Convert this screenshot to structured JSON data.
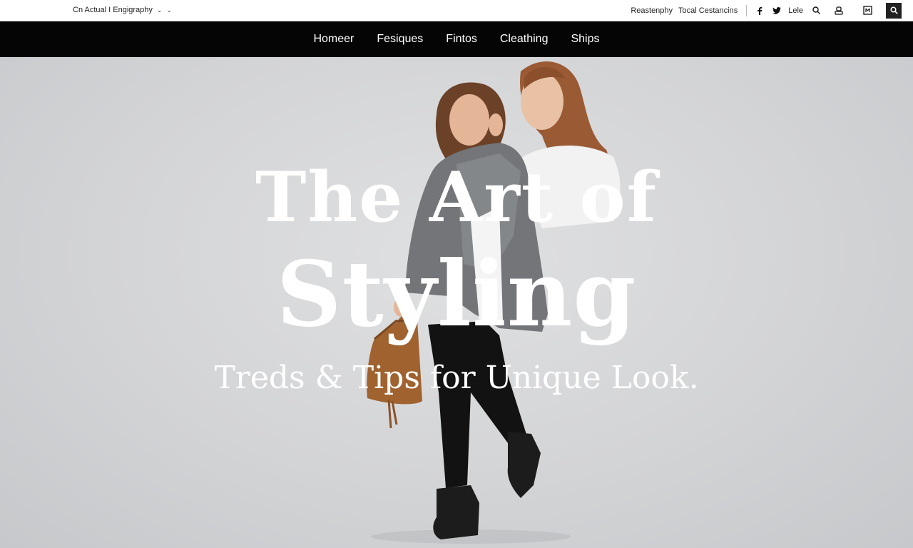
{
  "topbar": {
    "language_selector": "Cn Actual I Engigraphy",
    "links": [
      "Reastenphy",
      "Tocal Cestancins"
    ],
    "social_text": "Lele"
  },
  "nav": {
    "items": [
      "Homeer",
      "Fesiques",
      "Fintos",
      "Cleathing",
      "Ships"
    ]
  },
  "hero": {
    "title_line1": "The Art of",
    "title_line2": "Styling",
    "subtitle": "Treds & Tips for Unique Look."
  },
  "colors": {
    "nav_background": "#050505",
    "hero_background": "#d4d5d7",
    "hero_text": "#ffffff"
  },
  "icons": [
    "chevron-down-icon",
    "facebook-icon",
    "twitter-icon",
    "search-icon",
    "user-icon",
    "bag-icon",
    "search-icon"
  ]
}
